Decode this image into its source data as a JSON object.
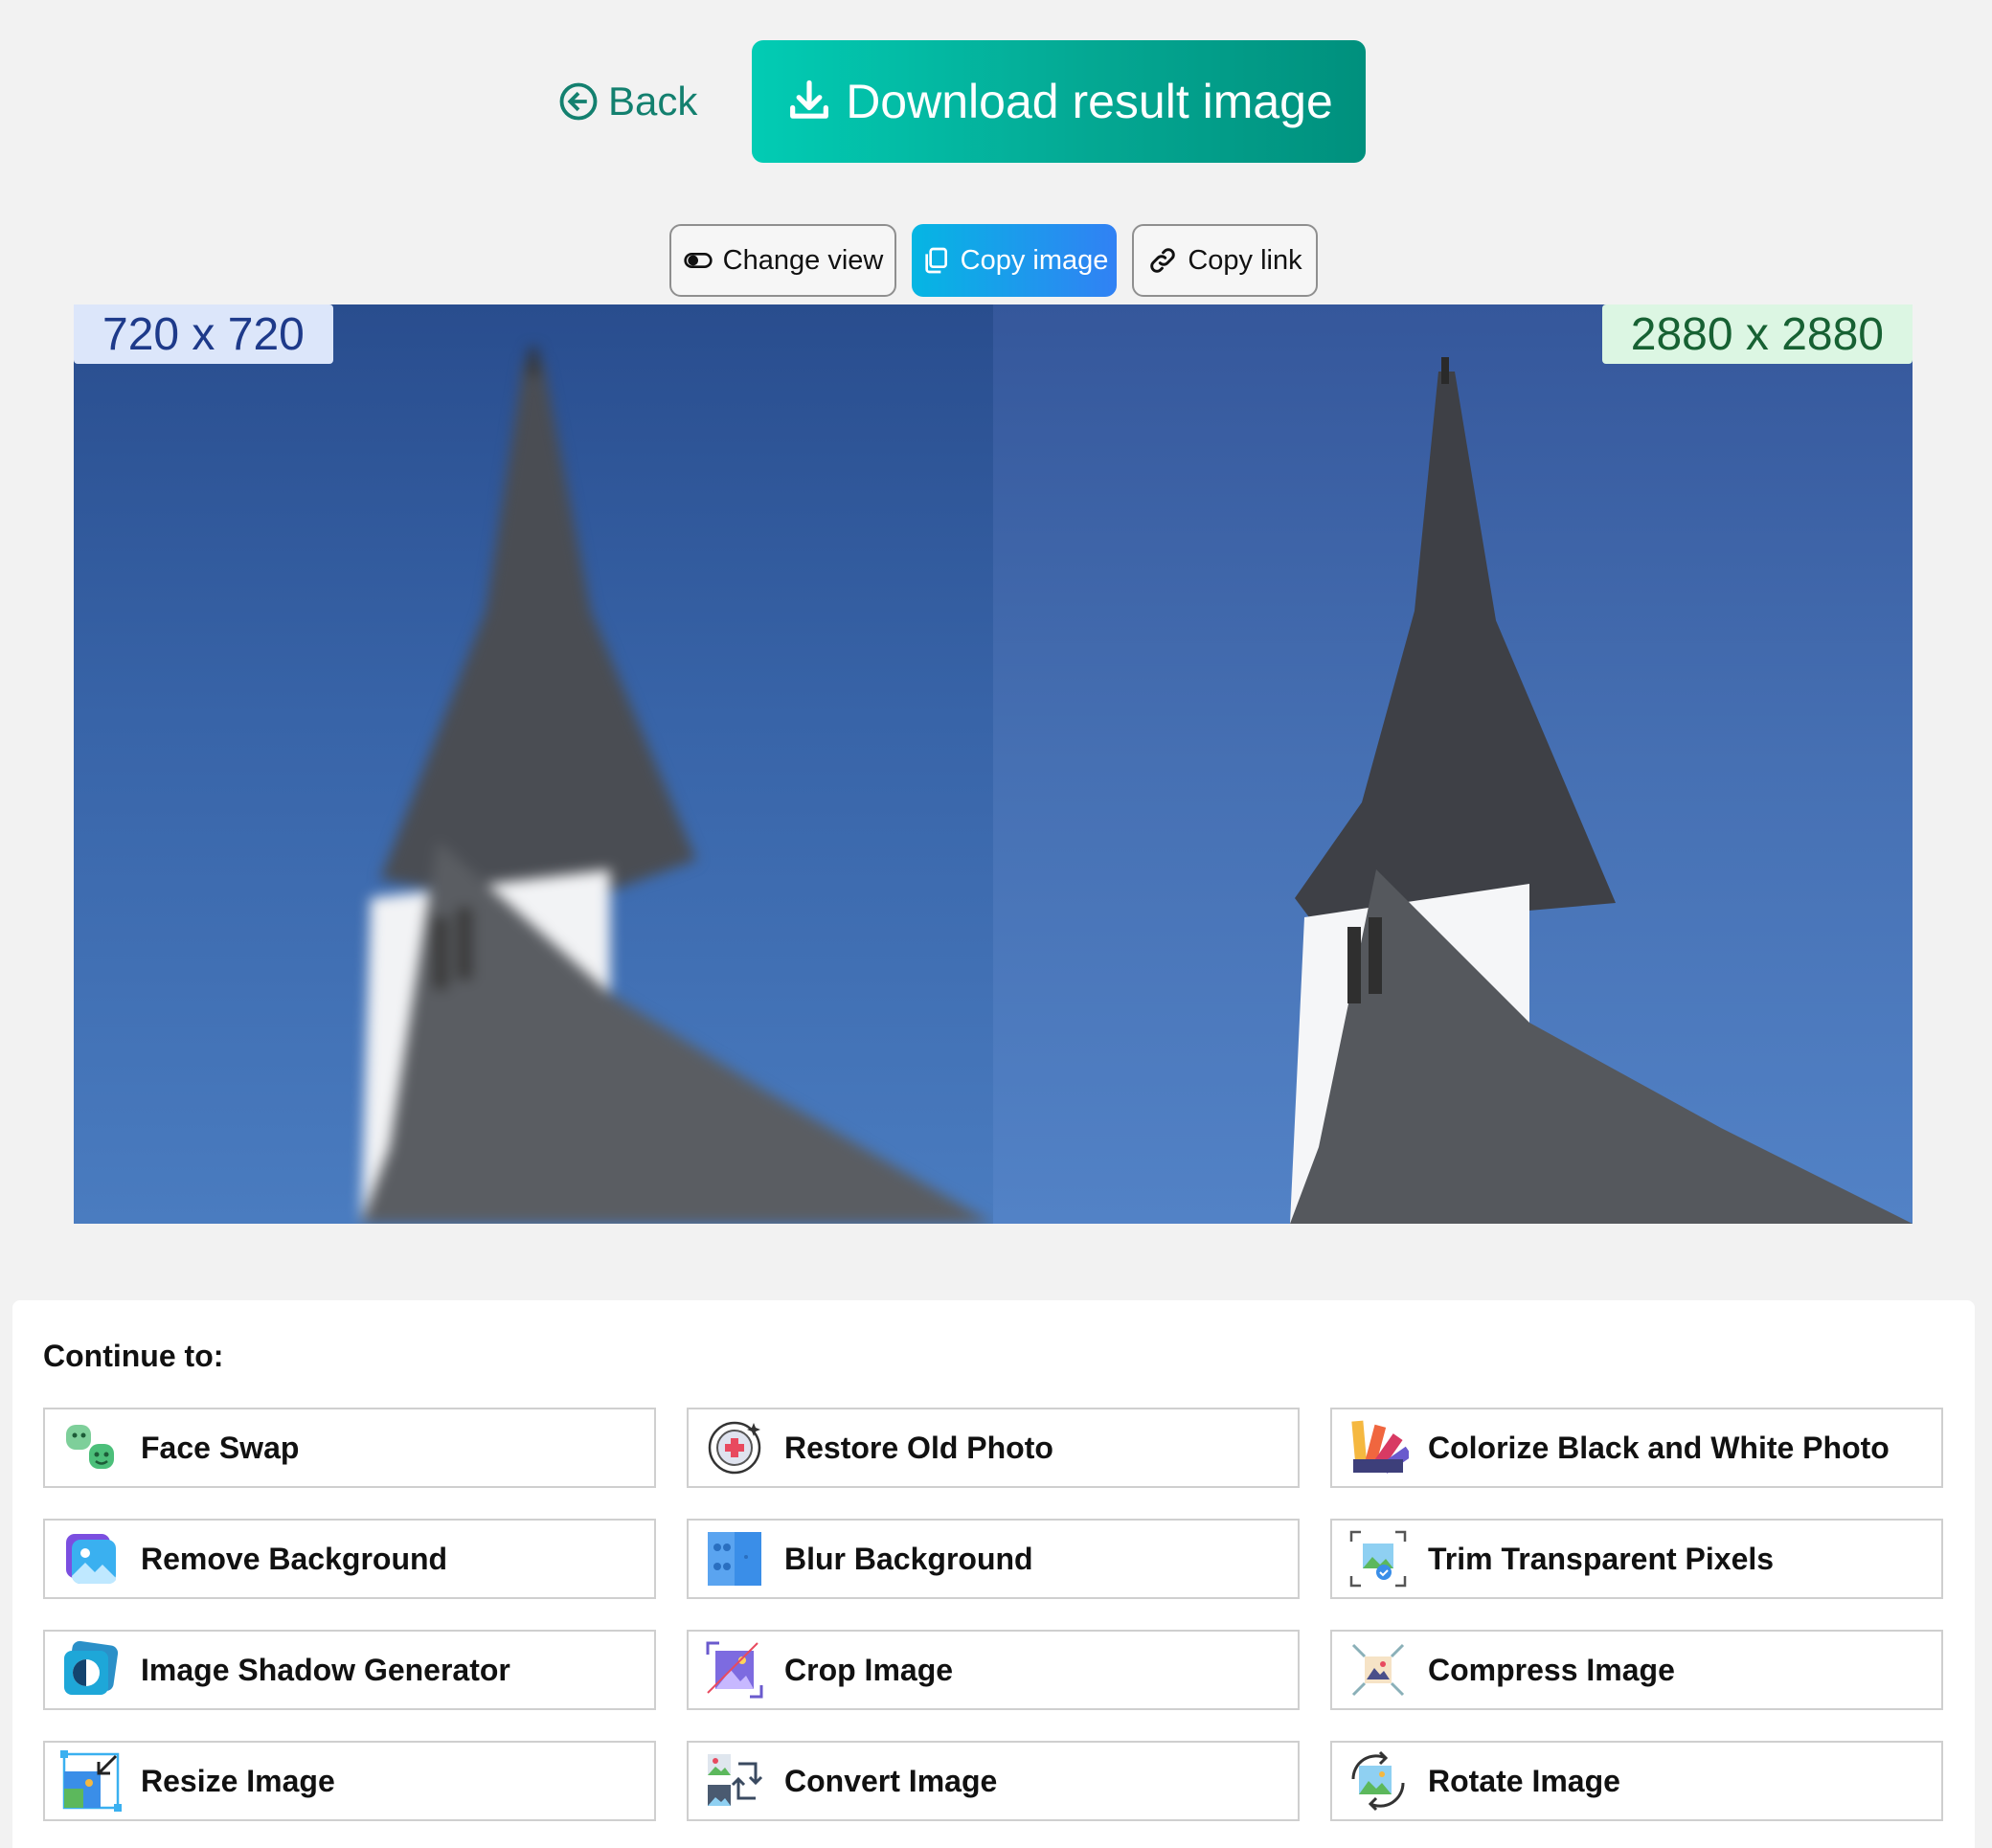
{
  "top_bar": {
    "back_label": "Back",
    "download_label": "Download result image"
  },
  "toolbar": {
    "change_view_label": "Change view",
    "copy_image_label": "Copy image",
    "copy_link_label": "Copy link"
  },
  "compare": {
    "original_size": "720 x 720",
    "result_size": "2880 x 2880"
  },
  "continue": {
    "title": "Continue to:",
    "tools": [
      {
        "label": "Face Swap",
        "icon": "face-swap-icon"
      },
      {
        "label": "Restore Old Photo",
        "icon": "restore-photo-icon"
      },
      {
        "label": "Colorize Black and White Photo",
        "icon": "color-palette-icon"
      },
      {
        "label": "Remove Background",
        "icon": "remove-background-icon"
      },
      {
        "label": "Blur Background",
        "icon": "blur-background-icon"
      },
      {
        "label": "Trim Transparent Pixels",
        "icon": "trim-pixels-icon"
      },
      {
        "label": "Image Shadow Generator",
        "icon": "shadow-generator-icon"
      },
      {
        "label": "Crop Image",
        "icon": "crop-icon"
      },
      {
        "label": "Compress Image",
        "icon": "compress-icon"
      },
      {
        "label": "Resize Image",
        "icon": "resize-icon"
      },
      {
        "label": "Convert Image",
        "icon": "convert-icon"
      },
      {
        "label": "Rotate Image",
        "icon": "rotate-icon"
      }
    ]
  },
  "colors": {
    "accent_teal": "#04a893",
    "copy_blue": "#3181f4",
    "back_text": "#13806f",
    "badge_left_bg": "#dce6fa",
    "badge_right_bg": "#dcf6e3"
  }
}
